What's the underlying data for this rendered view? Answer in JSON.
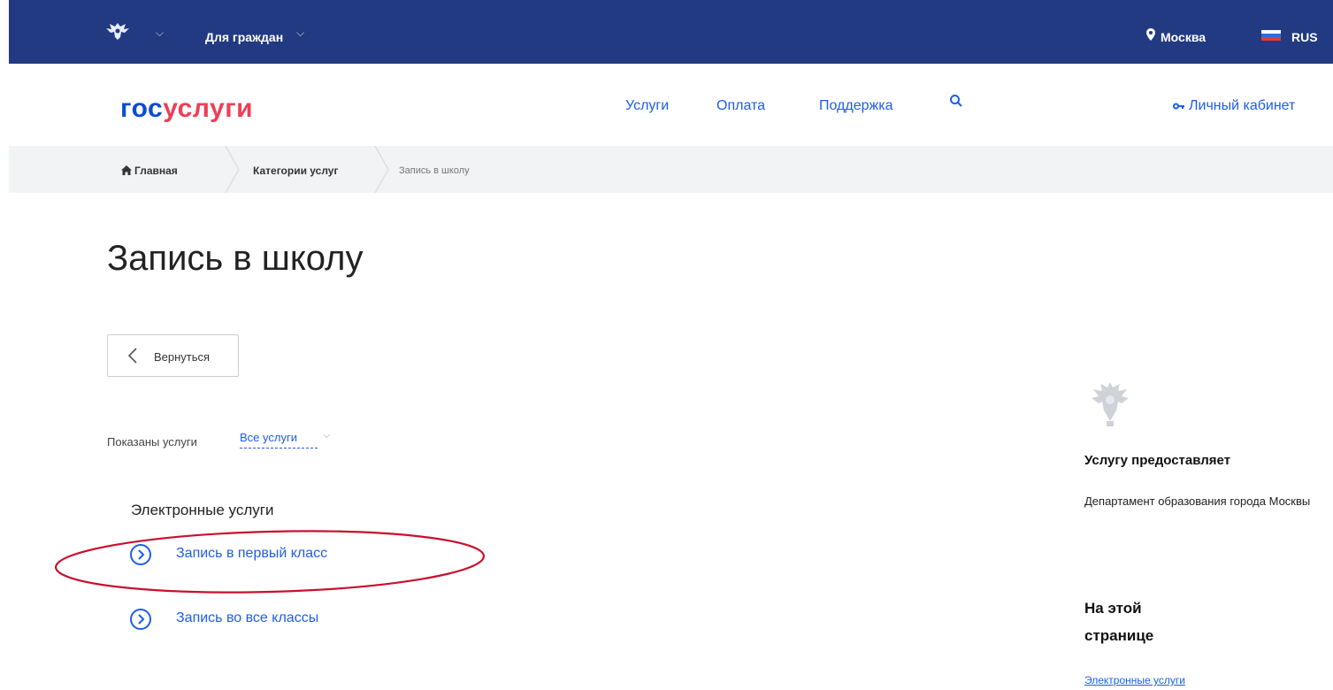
{
  "topbar": {
    "audience": "Для граждан",
    "city": "Москва",
    "language": "RUS",
    "bg_color": "#213a82"
  },
  "header": {
    "logo_part1": "гос",
    "logo_part2": "услуги",
    "nav": [
      "Услуги",
      "Оплата",
      "Поддержка"
    ],
    "cabinet": "Личный кабинет"
  },
  "breadcrumbs": [
    "Главная",
    "Категории услуг",
    "Запись в школу"
  ],
  "main": {
    "title": "Запись в школу",
    "back_label": "Вернуться",
    "filter_label": "Показаны услуги",
    "filter_value": "Все услуги",
    "section_title": "Электронные услуги",
    "services": [
      "Запись в первый класс",
      "Запись во все классы"
    ]
  },
  "sidebar": {
    "provider_heading": "Услугу предоставляет",
    "provider_name": "Департамент образования города Москвы",
    "on_page_heading": "На этой странице",
    "on_page_link": "Электронные услуги"
  },
  "colors": {
    "accent": "#1d5deb",
    "logo_red": "#ee3f58",
    "logo_blue": "#0d4cd3",
    "highlight_ellipse": "#c8102e"
  },
  "icons": [
    "emblem-icon",
    "chevron-down-icon",
    "location-pin-icon",
    "flag-ru-icon",
    "search-icon",
    "key-icon",
    "home-icon",
    "chevron-left-icon",
    "arrow-circle-right-icon"
  ]
}
